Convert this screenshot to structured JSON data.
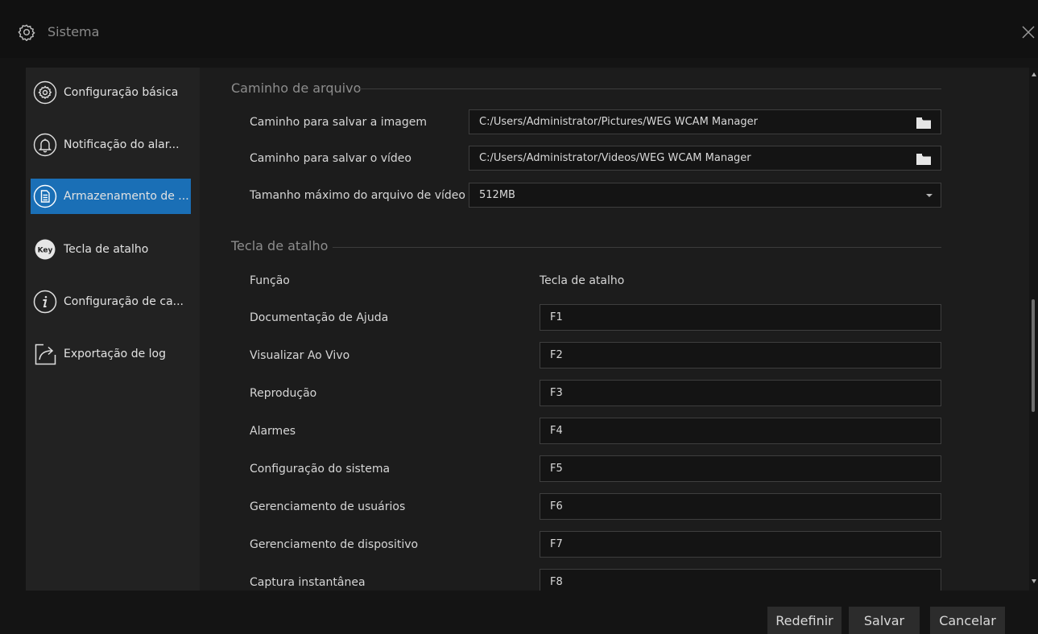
{
  "window": {
    "title": "Sistema",
    "title_icon": "gear-icon",
    "close_icon": "close-icon"
  },
  "sidebar": {
    "items": [
      {
        "label": "Configuração básica",
        "icon": "gear-icon",
        "active": false
      },
      {
        "label": "Notificação do alar...",
        "icon": "bell-icon",
        "active": false
      },
      {
        "label": "Armazenamento de ...",
        "icon": "document-icon",
        "active": true
      },
      {
        "label": "Tecla de atalho",
        "icon": "key-icon",
        "active": false
      },
      {
        "label": "Configuração de ca...",
        "icon": "info-icon",
        "active": false
      },
      {
        "label": "Exportação de log",
        "icon": "export-icon",
        "active": false
      }
    ],
    "key_icon_text": "Key"
  },
  "file_path": {
    "section_title": "Caminho de arquivo",
    "image_path": {
      "label": "Caminho para salvar a imagem",
      "value": "C:/Users/Administrator/Pictures/WEG WCAM Manager"
    },
    "video_path": {
      "label": "Caminho para salvar o vídeo",
      "value": "C:/Users/Administrator/Videos/WEG WCAM Manager"
    },
    "max_size": {
      "label": "Tamanho máximo do arquivo de vídeo",
      "value": "512MB"
    }
  },
  "hotkeys": {
    "section_title": "Tecla de atalho",
    "col_function": "Função",
    "col_key": "Tecla de atalho",
    "rows": [
      {
        "function": "Documentação de Ajuda",
        "key": "F1"
      },
      {
        "function": "Visualizar Ao Vivo",
        "key": "F2"
      },
      {
        "function": "Reprodução",
        "key": "F3"
      },
      {
        "function": "Alarmes",
        "key": "F4"
      },
      {
        "function": "Configuração do sistema",
        "key": "F5"
      },
      {
        "function": "Gerenciamento de usuários",
        "key": "F6"
      },
      {
        "function": "Gerenciamento de dispositivo",
        "key": "F7"
      },
      {
        "function": "Captura instantânea",
        "key": "F8"
      }
    ]
  },
  "buttons": {
    "reset": "Redefinir",
    "save": "Salvar",
    "cancel": "Cancelar"
  },
  "colors": {
    "accent": "#1a6fb6",
    "background": "#141414"
  }
}
